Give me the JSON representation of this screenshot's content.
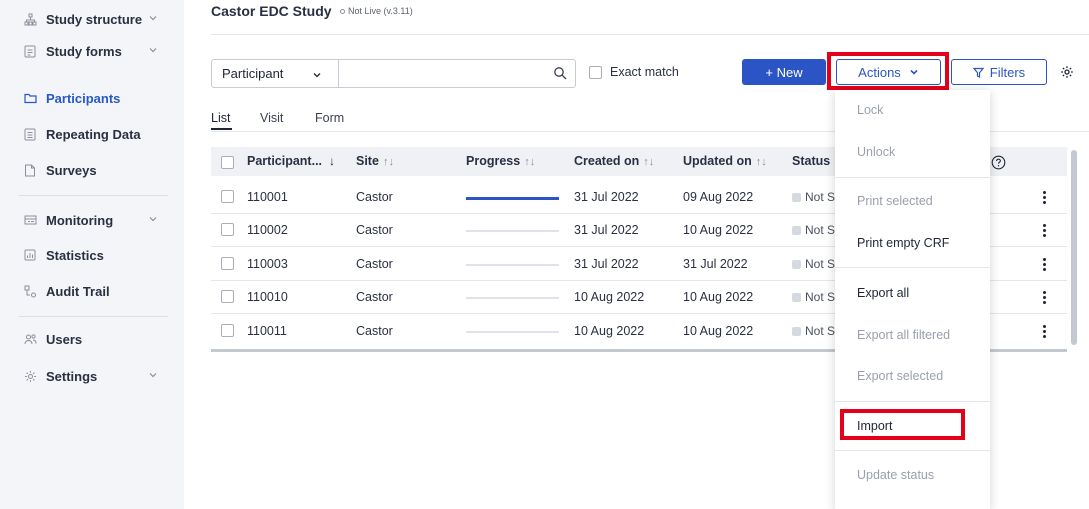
{
  "sidebar": {
    "items": [
      {
        "label": "Study structure",
        "icon": "sitemap-icon"
      },
      {
        "label": "Study forms",
        "icon": "form-icon"
      },
      {
        "label": "Participants",
        "icon": "folder-icon"
      },
      {
        "label": "Repeating Data",
        "icon": "list-icon"
      },
      {
        "label": "Surveys",
        "icon": "survey-icon"
      },
      {
        "label": "Monitoring",
        "icon": "monitor-icon"
      },
      {
        "label": "Statistics",
        "icon": "chart-icon"
      },
      {
        "label": "Audit Trail",
        "icon": "audit-icon"
      },
      {
        "label": "Users",
        "icon": "users-icon"
      },
      {
        "label": "Settings",
        "icon": "gear-icon"
      }
    ],
    "active": "Participants",
    "accent": "#2757c9"
  },
  "header": {
    "study_title": "Castor EDC Study",
    "study_status": "Not Live (v.3.11)"
  },
  "search": {
    "field_select": "Participant",
    "placeholder": "",
    "exact_match_label": "Exact match"
  },
  "toolbar": {
    "new_label": "+ New",
    "actions_label": "Actions",
    "filters_label": "Filters"
  },
  "tabs": [
    {
      "label": "List"
    },
    {
      "label": "Visit"
    },
    {
      "label": "Form"
    }
  ],
  "table": {
    "columns": [
      {
        "label": "Participant...",
        "sort": "↓"
      },
      {
        "label": "Site",
        "sort": "↑↓"
      },
      {
        "label": "Progress",
        "sort": "↑↓"
      },
      {
        "label": "Created on",
        "sort": "↑↓"
      },
      {
        "label": "Updated on",
        "sort": "↑↓"
      },
      {
        "label": "Status",
        "sort": ""
      }
    ],
    "rows": [
      {
        "id": "110001",
        "site": "Castor",
        "progress": 1.0,
        "created": "31 Jul 2022",
        "updated": "09 Aug 2022",
        "status": "Not S"
      },
      {
        "id": "110002",
        "site": "Castor",
        "progress": 0.0,
        "created": "31 Jul 2022",
        "updated": "10 Aug 2022",
        "status": "Not S"
      },
      {
        "id": "110003",
        "site": "Castor",
        "progress": 0.0,
        "created": "31 Jul 2022",
        "updated": "31 Jul 2022",
        "status": "Not S"
      },
      {
        "id": "110010",
        "site": "Castor",
        "progress": 0.0,
        "created": "10 Aug 2022",
        "updated": "10 Aug 2022",
        "status": "Not S"
      },
      {
        "id": "110011",
        "site": "Castor",
        "progress": 0.0,
        "created": "10 Aug 2022",
        "updated": "10 Aug 2022",
        "status": "Not S"
      }
    ]
  },
  "actions_menu": {
    "items": [
      {
        "label": "Lock",
        "enabled": false
      },
      {
        "label": "Unlock",
        "enabled": false
      },
      {
        "label": "Print selected",
        "enabled": false
      },
      {
        "label": "Print empty CRF",
        "enabled": true
      },
      {
        "label": "Export all",
        "enabled": true
      },
      {
        "label": "Export all filtered",
        "enabled": false
      },
      {
        "label": "Export selected",
        "enabled": false
      },
      {
        "label": "Import",
        "enabled": true
      },
      {
        "label": "Update status",
        "enabled": false
      }
    ],
    "highlight_color": "#e2001a"
  },
  "colors": {
    "primary": "#2b55c4",
    "sidebar_bg": "#f4f5f8",
    "highlight": "#e2001a"
  }
}
